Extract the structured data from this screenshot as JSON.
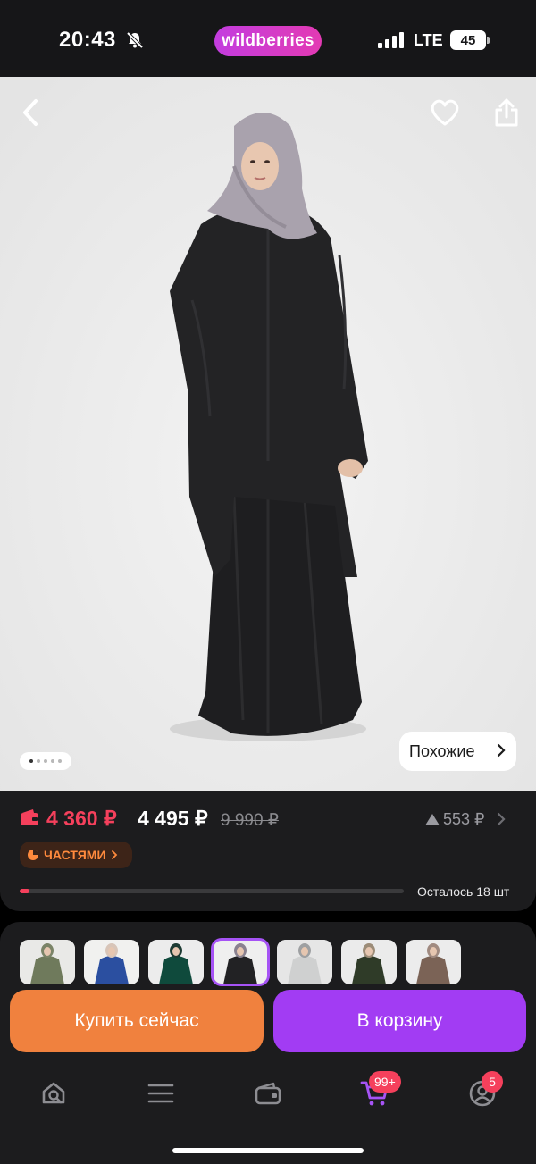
{
  "status_bar": {
    "time": "20:43",
    "brand": "wildberries",
    "network": "LTE",
    "battery": "45",
    "icons": [
      "bell-slash-icon",
      "signal-icon",
      "battery-icon"
    ]
  },
  "product_image": {
    "icons": [
      "chevron-left-icon",
      "heart-icon",
      "share-icon"
    ],
    "pager": {
      "count": 5,
      "active_index": 0
    },
    "similar_label": "Похожие",
    "background_color": "#ebebeb"
  },
  "price": {
    "wallet_price": "4 360 ₽",
    "price": "4 495 ₽",
    "old_price": "9 990 ₽",
    "trend": "553 ₽",
    "installment_label": "ЧАСТЯМИ",
    "stock_text": "Осталось 18 шт",
    "stock_fraction": 0.025,
    "colors": {
      "wallet_price": "#f5405c",
      "installment_text": "#ff8a3d"
    }
  },
  "variants": {
    "selected_index": 3,
    "items": [
      {
        "name": "olive"
      },
      {
        "name": "blue"
      },
      {
        "name": "emerald"
      },
      {
        "name": "black"
      },
      {
        "name": "light-grey"
      },
      {
        "name": "dark-green"
      },
      {
        "name": "mocha"
      }
    ]
  },
  "actions": {
    "buy_now": "Купить сейчас",
    "add_to_cart": "В корзину",
    "colors": {
      "buy_now": "#f0813e",
      "add_to_cart": "#a23cf3"
    }
  },
  "tabbar": {
    "items": [
      {
        "name": "home",
        "icon": "search-home-icon"
      },
      {
        "name": "catalog",
        "icon": "menu-icon"
      },
      {
        "name": "wallet",
        "icon": "wallet-icon"
      },
      {
        "name": "cart",
        "icon": "cart-icon",
        "badge": "99+",
        "active": true
      },
      {
        "name": "profile",
        "icon": "profile-icon",
        "badge": "5"
      }
    ]
  }
}
